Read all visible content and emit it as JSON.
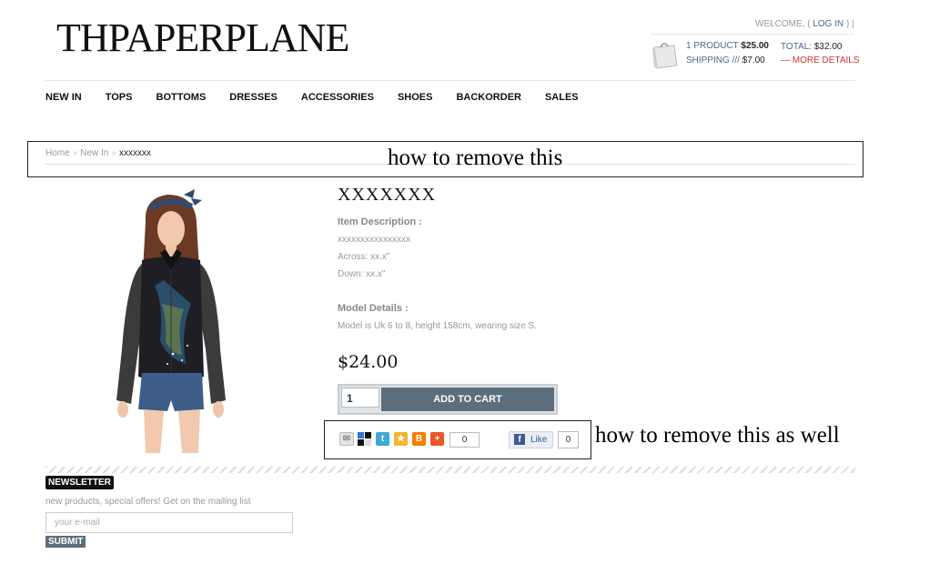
{
  "header": {
    "logo": "THPAPERPLANE",
    "welcome_prefix": "WELCOME, (",
    "login_label": "LOG IN",
    "welcome_suffix": ")  |",
    "cart": {
      "items": "1 PRODUCT",
      "items_price": "$25.00",
      "shipping_label": "SHIPPING ///",
      "shipping_price": "$7.00",
      "total_label": "TOTAL:",
      "total_price": "$32.00",
      "more_details": "— MORE DETAILS"
    }
  },
  "nav": [
    "NEW IN",
    "TOPS",
    "BOTTOMS",
    "DRESSES",
    "ACCESSORIES",
    "SHOES",
    "BACKORDER",
    "SALES"
  ],
  "breadcrumb": {
    "home": "Home",
    "section": "New In",
    "current": "xxxxxxx"
  },
  "annotations": {
    "first": "how to remove this",
    "second": "how to remove this as well"
  },
  "product": {
    "title": "XXXXXXX",
    "item_desc_heading": "Item Description :",
    "desc_lines": [
      "xxxxxxxxxxxxxxxx",
      "Across: xx.x\"",
      "Down: xx.x\""
    ],
    "model_heading": "Model Details :",
    "model_text": "Model is Uk 6 to 8, height 158cm, wearing size S.",
    "price": "$24.00",
    "quantity": "1",
    "add_to_cart": "ADD TO CART"
  },
  "share": {
    "count": "0",
    "like_label": "Like",
    "like_count": "0"
  },
  "newsletter": {
    "badge": "NEWSLETTER",
    "text": "new products, special offers! Get on the mailing list",
    "placeholder": "your e-mail",
    "submit": "SUBMIT"
  },
  "colors": {
    "accent": "#5c6e7c",
    "link": "#4a6b8a",
    "alert": "#cc3333",
    "facebook": "#3b5998"
  },
  "icons": [
    "email-icon",
    "delicious-icon",
    "twitter-icon",
    "favorite-icon",
    "blogger-icon",
    "more-share-icon",
    "facebook-icon",
    "shopping-bag-icon"
  ]
}
